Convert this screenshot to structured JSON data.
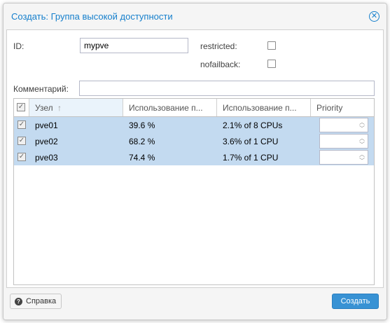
{
  "dialog": {
    "title": "Создать: Группа высокой доступности",
    "close_glyph": "⊗"
  },
  "form": {
    "id_label": "ID:",
    "id_value": "mypve",
    "restricted_label": "restricted:",
    "restricted_checked": false,
    "nofailback_label": "nofailback:",
    "nofailback_checked": false,
    "comment_label": "Комментарий:",
    "comment_value": ""
  },
  "grid": {
    "columns": [
      "Узел",
      "Использование п...",
      "Использование п...",
      "Priority"
    ],
    "sort_indicator": "↑",
    "rows": [
      {
        "node": "pve01",
        "mem": "39.6 %",
        "cpu": "2.1% of 8 CPUs",
        "priority": "",
        "checked": true
      },
      {
        "node": "pve02",
        "mem": "68.2 %",
        "cpu": "3.6% of 1 CPU",
        "priority": "",
        "checked": true
      },
      {
        "node": "pve03",
        "mem": "74.4 %",
        "cpu": "1.7% of 1 CPU",
        "priority": "",
        "checked": true
      }
    ],
    "checkmark": "✓"
  },
  "footer": {
    "help_label": "Справка",
    "help_icon": "?",
    "create_label": "Создать"
  },
  "colors": {
    "accent": "#157fcc",
    "selected_row": "#c3daf0",
    "primary_button": "#3892d4"
  }
}
